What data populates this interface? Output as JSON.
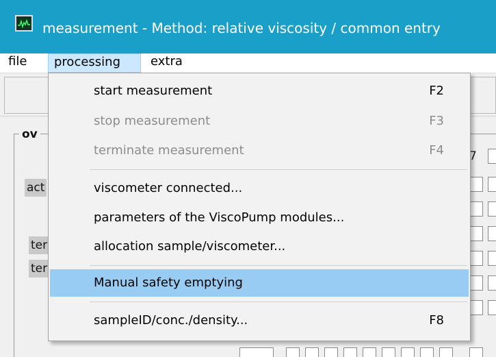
{
  "window": {
    "title": "measurement  -  Method: relative viscosity  / common entry"
  },
  "menubar": {
    "items": [
      {
        "label": "file"
      },
      {
        "label": "processing"
      },
      {
        "label": "extra"
      }
    ]
  },
  "background": {
    "group_label": "ov",
    "labels": [
      "act",
      "ter",
      "ter"
    ],
    "column_header": "7"
  },
  "dropdown": {
    "items": [
      {
        "label": "start measurement",
        "shortcut": "F2"
      },
      {
        "label": "stop measurement",
        "shortcut": "F3"
      },
      {
        "label": "terminate measurement",
        "shortcut": "F4"
      },
      {
        "label": "viscometer connected..."
      },
      {
        "label": "parameters of the ViscoPump modules..."
      },
      {
        "label": "allocation sample/viscometer..."
      },
      {
        "label": "Manual safety emptying"
      },
      {
        "label": "sampleID/conc./density...",
        "shortcut": "F8"
      }
    ]
  },
  "colors": {
    "titlebar": "#1aa0c8",
    "menu_active": "#cce8ff",
    "item_highlight": "#99ccf3",
    "disabled_text": "#8c8c8c"
  }
}
